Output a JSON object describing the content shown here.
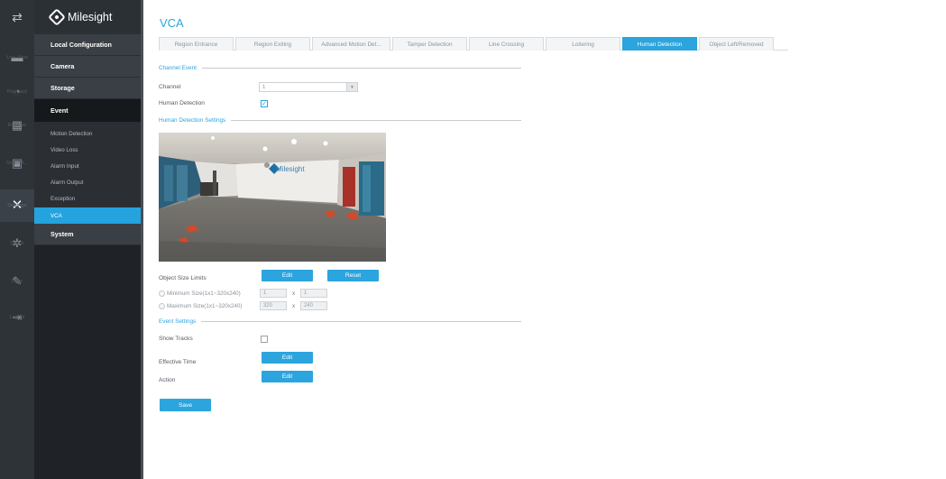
{
  "rail": {
    "items": [
      {
        "label": "Live View",
        "icon": "live-view-icon"
      },
      {
        "label": "Playback",
        "icon": "playback-icon"
      },
      {
        "label": "Retrieve",
        "icon": "retrieve-icon"
      },
      {
        "label": "Smart A...",
        "icon": "smart-analytics-icon"
      },
      {
        "label": "Settings",
        "icon": "settings-icon"
      },
      {
        "label": "Status",
        "icon": "status-icon"
      },
      {
        "label": "Logs",
        "icon": "logs-icon"
      },
      {
        "label": "Logout",
        "icon": "logout-icon"
      }
    ]
  },
  "brand": {
    "name": "Milesight"
  },
  "menu": {
    "local_configuration": "Local Configuration",
    "camera": "Camera",
    "storage": "Storage",
    "event": "Event",
    "system": "System",
    "event_items": [
      "Motion Detection",
      "Video Loss",
      "Alarm Input",
      "Alarm Output",
      "Exception",
      "VCA"
    ]
  },
  "page": {
    "title": "VCA"
  },
  "tabs": [
    "Region Entrance",
    "Region Exiting",
    "Advanced Motion Det...",
    "Tamper Detection",
    "Line Crossing",
    "Loitering",
    "Human Detection",
    "Object Left/Removed"
  ],
  "sections": {
    "channel_event": "Channel Event",
    "settings": "Human Detection Settings",
    "event_settings": "Event Settings"
  },
  "form": {
    "channel_label": "Channel",
    "channel_value": "1",
    "human_detection_label": "Human Detection",
    "human_detection_checked": true,
    "object_size_limits_label": "Object Size Limits",
    "edit_label": "Edit",
    "reset_label": "Reset",
    "min_size_label": "Minimum Size(1x1~320x240)",
    "min_w": "1",
    "min_h": "1",
    "max_size_label": "Maximum Size(1x1~320x240)",
    "max_w": "320",
    "max_h": "240",
    "times": "x",
    "show_tracks_label": "Show Tracks",
    "show_tracks_checked": false,
    "effective_time_label": "Effective Time",
    "action_label": "Action",
    "save_label": "Save"
  },
  "preview": {
    "wall_logo": "Milesight"
  },
  "colors": {
    "accent": "#2ca4dd",
    "rail_bg": "#2e3338",
    "menu_bg": "#1f2327"
  }
}
